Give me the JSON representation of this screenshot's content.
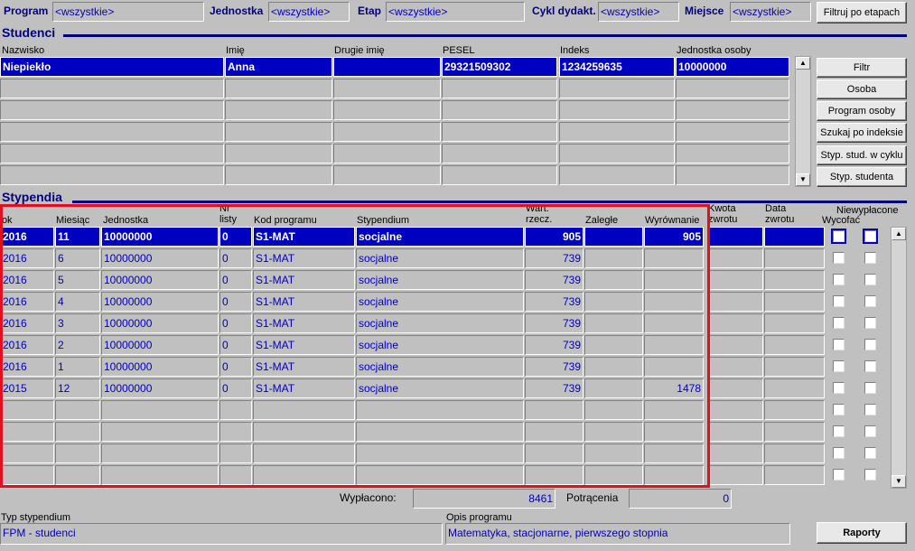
{
  "filters": {
    "program_label": "Program",
    "program_value": "<wszystkie>",
    "jednostka_label": "Jednostka",
    "jednostka_value": "<wszystkie>",
    "etap_label": "Etap",
    "etap_value": "<wszystkie>",
    "cykl_label": "Cykl dydakt.",
    "cykl_value": "<wszystkie>",
    "miejsce_label": "Miejsce",
    "miejsce_value": "<wszystkie>",
    "filter_button": "Filtruj po etapach"
  },
  "studenci": {
    "title": "Studenci",
    "headers": {
      "nazwisko": "Nazwisko",
      "imie": "Imię",
      "drugie_imie": "Drugie imię",
      "pesel": "PESEL",
      "indeks": "Indeks",
      "jednostka": "Jednostka osoby"
    },
    "rows": [
      {
        "nazwisko": "Niepiekło",
        "imie": "Anna",
        "drugie_imie": "",
        "pesel": "29321509302",
        "indeks": "1234259635",
        "jednostka": "10000000"
      }
    ],
    "buttons": [
      "Filtr",
      "Osoba",
      "Program osoby",
      "Szukaj po indeksie",
      "Styp. stud. w cyklu",
      "Styp. studenta"
    ]
  },
  "stypendia": {
    "title": "Stypendia",
    "headers": {
      "rok": "Rok",
      "miesiac": "Miesiąc",
      "jednostka": "Jednostka",
      "nr_listy_1": "Nr",
      "nr_listy_2": "listy",
      "kod_programu": "Kod programu",
      "stypendium": "Stypendium",
      "wart_1": "Wart.",
      "wart_2": "rzecz.",
      "zalegle": "Zaległe",
      "wyrownanie": "Wyrównanie",
      "kwota_1": "Kwota",
      "kwota_2": "zwrotu",
      "data_1": "Data",
      "data_2": "zwrotu",
      "niewyplacone": "Niewypłacone",
      "wycofac": "Wycofać"
    },
    "rows": [
      {
        "rok": "2016",
        "miesiac": "11",
        "jednostka": "10000000",
        "nr": "0",
        "kod": "S1-MAT",
        "stypendium": "socjalne",
        "wart": "905",
        "zalegle": "",
        "wyrownanie": "905"
      },
      {
        "rok": "2016",
        "miesiac": "6",
        "jednostka": "10000000",
        "nr": "0",
        "kod": "S1-MAT",
        "stypendium": "socjalne",
        "wart": "739",
        "zalegle": "",
        "wyrownanie": ""
      },
      {
        "rok": "2016",
        "miesiac": "5",
        "jednostka": "10000000",
        "nr": "0",
        "kod": "S1-MAT",
        "stypendium": "socjalne",
        "wart": "739",
        "zalegle": "",
        "wyrownanie": ""
      },
      {
        "rok": "2016",
        "miesiac": "4",
        "jednostka": "10000000",
        "nr": "0",
        "kod": "S1-MAT",
        "stypendium": "socjalne",
        "wart": "739",
        "zalegle": "",
        "wyrownanie": ""
      },
      {
        "rok": "2016",
        "miesiac": "3",
        "jednostka": "10000000",
        "nr": "0",
        "kod": "S1-MAT",
        "stypendium": "socjalne",
        "wart": "739",
        "zalegle": "",
        "wyrownanie": ""
      },
      {
        "rok": "2016",
        "miesiac": "2",
        "jednostka": "10000000",
        "nr": "0",
        "kod": "S1-MAT",
        "stypendium": "socjalne",
        "wart": "739",
        "zalegle": "",
        "wyrownanie": ""
      },
      {
        "rok": "2016",
        "miesiac": "1",
        "jednostka": "10000000",
        "nr": "0",
        "kod": "S1-MAT",
        "stypendium": "socjalne",
        "wart": "739",
        "zalegle": "",
        "wyrownanie": ""
      },
      {
        "rok": "2015",
        "miesiac": "12",
        "jednostka": "10000000",
        "nr": "0",
        "kod": "S1-MAT",
        "stypendium": "socjalne",
        "wart": "739",
        "zalegle": "",
        "wyrownanie": "1478"
      }
    ],
    "wyplacono_label": "Wypłacono:",
    "wyplacono_value": "8461",
    "potracenia_label": "Potrącenia",
    "potracenia_value": "0"
  },
  "footer": {
    "typ_label": "Typ stypendium",
    "typ_value": "FPM - studenci",
    "opis_label": "Opis programu",
    "opis_value": "Matematyka, stacjonarne, pierwszego stopnia",
    "raporty_button": "Raporty"
  },
  "colors": {
    "selection": "#0000c0",
    "section_title": "#000080",
    "highlight_box": "#e01020"
  }
}
